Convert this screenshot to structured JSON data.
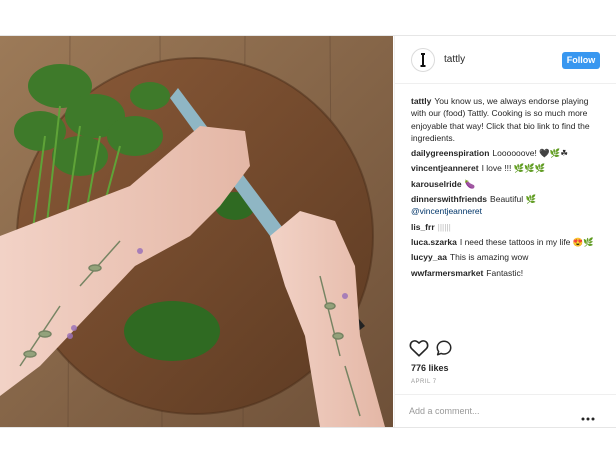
{
  "post": {
    "username": "tattly",
    "follow_label": "Follow",
    "caption_user": "tattly",
    "caption_text": "You know us, we always endorse playing with our (food) Tattly. Cooking is so much more enjoyable that way! Click that bio link to find the ingredients.",
    "comments": [
      {
        "user": "dailygreenspiration",
        "text": "Loooooove! 🖤🌿☘"
      },
      {
        "user": "vincentjeanneret",
        "text": "I love !!! 🌿🌿🌿"
      },
      {
        "user": "karouselride",
        "text": "🍆"
      },
      {
        "user": "dinnerswithfriends",
        "text": "Beautiful 🌿",
        "mention": "@vincentjeanneret"
      },
      {
        "user": "lis_frr",
        "text": "||||||",
        "muted": true
      },
      {
        "user": "luca.szarka",
        "text": "I need these tattoos in my life 😍🌿"
      },
      {
        "user": "lucyy_aa",
        "text": "This is amazing wow"
      },
      {
        "user": "wwfarmersmarket",
        "text": "Fantastic!"
      }
    ],
    "likes": "776 likes",
    "date": "APRIL 7",
    "add_comment_placeholder": "Add a comment...",
    "icons": {
      "like": "heart-icon",
      "comment": "comment-icon",
      "more": "more-options-icon",
      "avatar": "tattly-logo-icon"
    },
    "colors": {
      "follow_button": "#3897f0",
      "mention": "#003569",
      "timestamp": "#999999"
    }
  }
}
